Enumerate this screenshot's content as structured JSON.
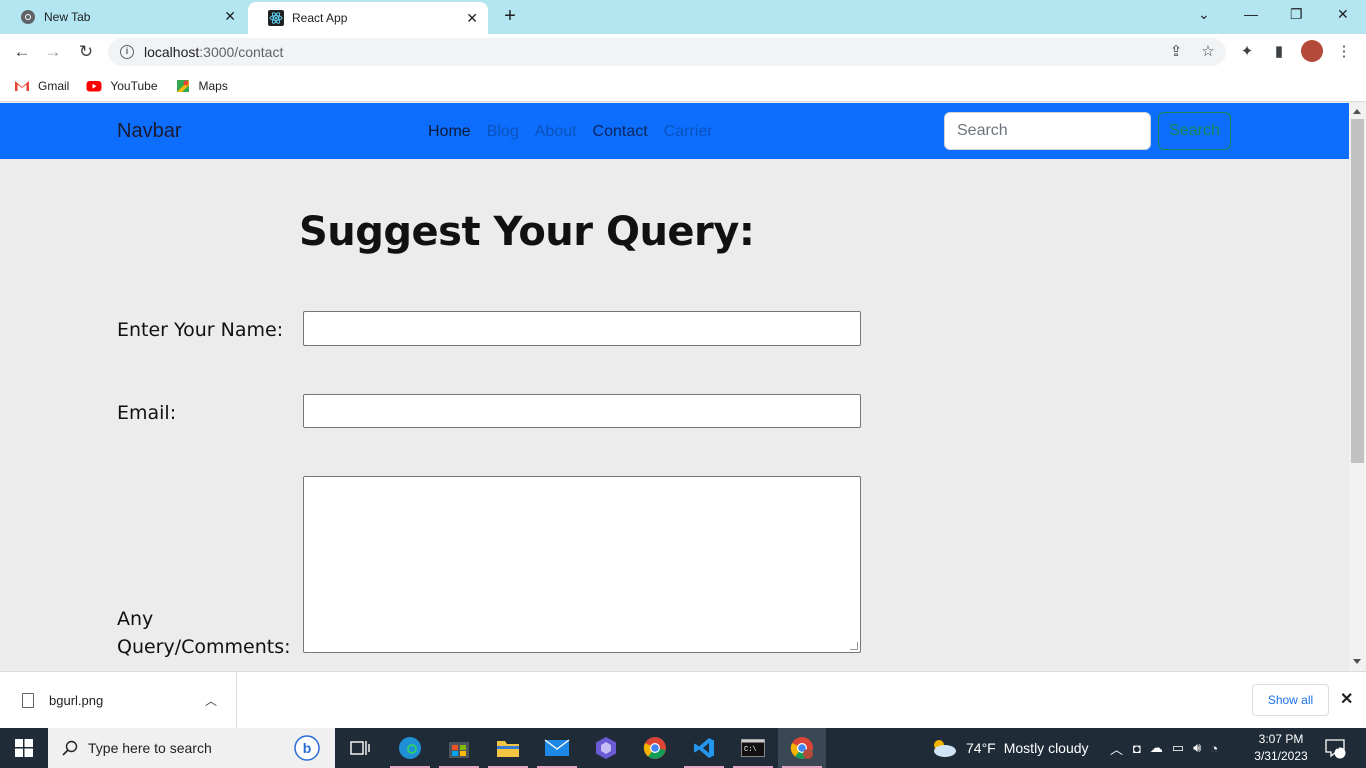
{
  "browser": {
    "tabs": [
      {
        "title": "New Tab",
        "active": false
      },
      {
        "title": "React App",
        "active": true
      }
    ],
    "url": {
      "host": "localhost",
      "path": ":3000/contact"
    },
    "bookmarks": [
      {
        "label": "Gmail",
        "icon": "gmail-icon"
      },
      {
        "label": "YouTube",
        "icon": "youtube-icon"
      },
      {
        "label": "Maps",
        "icon": "maps-icon"
      }
    ]
  },
  "navbar": {
    "brand": "Navbar",
    "links": [
      "Home",
      "Blog",
      "About",
      "Contact",
      "Carrier"
    ],
    "search_placeholder": "Search",
    "search_button": "Search"
  },
  "form": {
    "heading": "Suggest Your Query:",
    "name_label": "Enter Your Name:",
    "email_label": "Email:",
    "comments_label_line1": "Any",
    "comments_label_line2": "Query/Comments:"
  },
  "downloads": {
    "file": "bgurl.png",
    "show_all": "Show all"
  },
  "taskbar": {
    "search_placeholder": "Type here to search",
    "weather_temp": "74°F",
    "weather_desc": "Mostly cloudy",
    "time": "3:07 PM",
    "date": "3/31/2023",
    "notifications": "7"
  },
  "colors": {
    "navbar_bg": "#0d6efd",
    "search_button": "#198754",
    "tabstrip": "#b3e6f0",
    "page_bg": "#ececec"
  }
}
